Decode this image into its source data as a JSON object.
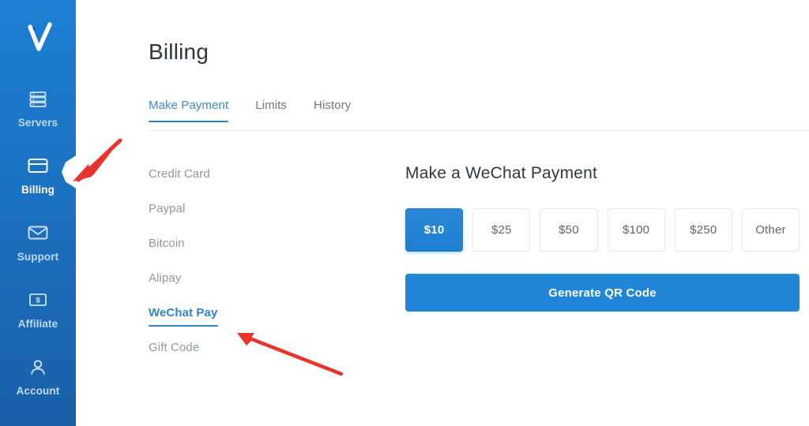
{
  "sidebar": {
    "logo_name": "checkmark-v-logo",
    "items": [
      {
        "label": "Servers",
        "icon": "server-rack-icon",
        "active": false
      },
      {
        "label": "Billing",
        "icon": "credit-card-icon",
        "active": true
      },
      {
        "label": "Support",
        "icon": "envelope-icon",
        "active": false
      },
      {
        "label": "Affiliate",
        "icon": "money-bill-icon",
        "active": false
      },
      {
        "label": "Account",
        "icon": "user-person-icon",
        "active": false
      }
    ]
  },
  "page": {
    "title": "Billing"
  },
  "tabs": [
    {
      "label": "Make Payment",
      "active": true
    },
    {
      "label": "Limits",
      "active": false
    },
    {
      "label": "History",
      "active": false
    }
  ],
  "payment_methods": [
    {
      "label": "Credit Card",
      "active": false
    },
    {
      "label": "Paypal",
      "active": false
    },
    {
      "label": "Bitcoin",
      "active": false
    },
    {
      "label": "Alipay",
      "active": false
    },
    {
      "label": "WeChat Pay",
      "active": true
    },
    {
      "label": "Gift Code",
      "active": false
    }
  ],
  "panel": {
    "heading": "Make a WeChat Payment",
    "amounts": [
      {
        "label": "$10",
        "selected": true
      },
      {
        "label": "$25",
        "selected": false
      },
      {
        "label": "$50",
        "selected": false
      },
      {
        "label": "$100",
        "selected": false
      },
      {
        "label": "$250",
        "selected": false
      },
      {
        "label": "Other",
        "selected": false
      }
    ],
    "generate_button": "Generate QR Code"
  },
  "annotations": {
    "arrow_color": "#e8342a",
    "arrows": [
      {
        "name": "arrow-to-billing-nav",
        "points_to": "Billing"
      },
      {
        "name": "arrow-to-wechat-pay",
        "points_to": "WeChat Pay"
      }
    ]
  },
  "colors": {
    "sidebar_top": "#1d7fd4",
    "sidebar_bottom": "#1a5fa8",
    "accent_blue": "#2186d8",
    "tab_active": "#2e86c9",
    "muted_text": "#8e98a3",
    "arrow_red": "#e8342a"
  }
}
